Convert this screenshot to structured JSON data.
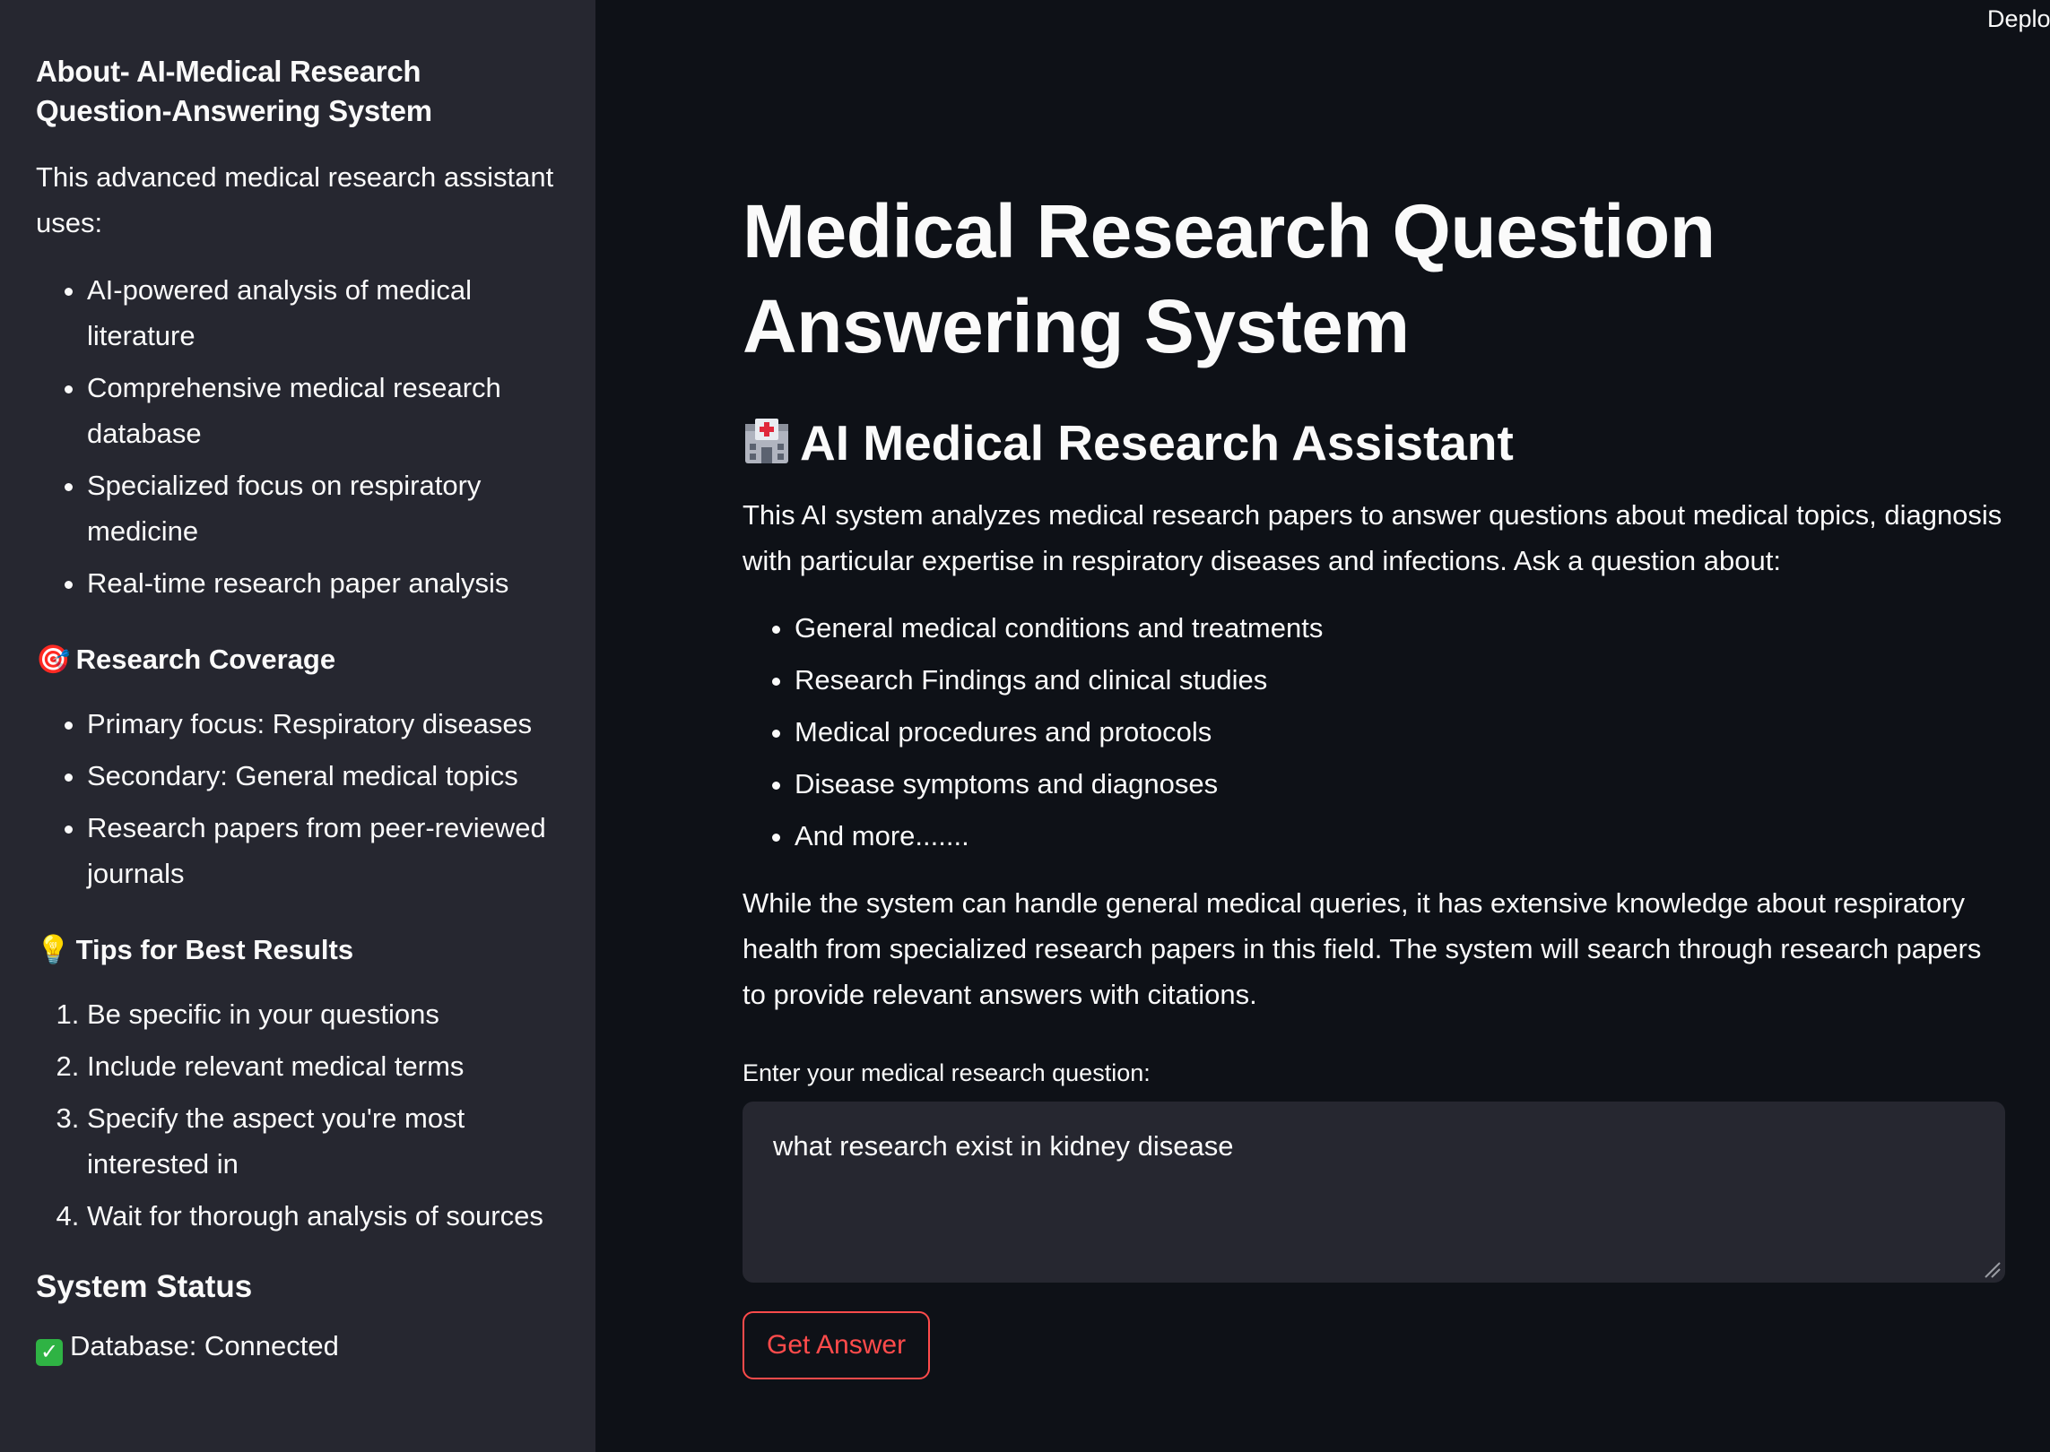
{
  "deploy_label": "Deplo",
  "sidebar": {
    "title": "About- AI-Medical Research Question-Answering System",
    "intro": "This advanced medical research assistant uses:",
    "features": [
      "AI-powered analysis of medical literature",
      "Comprehensive medical research database",
      "Specialized focus on respiratory medicine",
      "Real-time research paper analysis"
    ],
    "coverage": {
      "emoji": "🎯",
      "heading": "Research Coverage",
      "items": [
        "Primary focus: Respiratory diseases",
        "Secondary: General medical topics",
        "Research papers from peer-reviewed journals"
      ]
    },
    "tips": {
      "emoji": "💡",
      "heading": "Tips for Best Results",
      "items": [
        "Be specific in your questions",
        "Include relevant medical terms",
        "Specify the aspect you're most interested in",
        "Wait for thorough analysis of sources"
      ]
    },
    "status": {
      "heading": "System Status",
      "database": "Database: Connected",
      "check_glyph": "✓"
    }
  },
  "main": {
    "title": "Medical Research Question Answering System",
    "subtitle": "AI Medical Research Assistant",
    "subtitle_icon": "hospital-icon",
    "description": "This AI system analyzes medical research papers to answer questions about medical topics, diagnosis with particular expertise in respiratory diseases and infections. Ask a question about:",
    "topics": [
      "General medical conditions and treatments",
      "Research Findings and clinical studies",
      "Medical procedures and protocols",
      "Disease symptoms and diagnoses",
      "And more......."
    ],
    "note": "While the system can handle general medical queries, it has extensive knowledge about respiratory health from specialized research papers in this field. The system will search through research papers to provide relevant answers with citations.",
    "question_label": "Enter your medical research question:",
    "question_value": "what research exist in kidney disease",
    "submit_label": "Get Answer"
  },
  "colors": {
    "background": "#0e1117",
    "sidebar": "#262730",
    "accent": "#ff4b4b",
    "text": "#fafafa",
    "success": "#2fb344"
  }
}
